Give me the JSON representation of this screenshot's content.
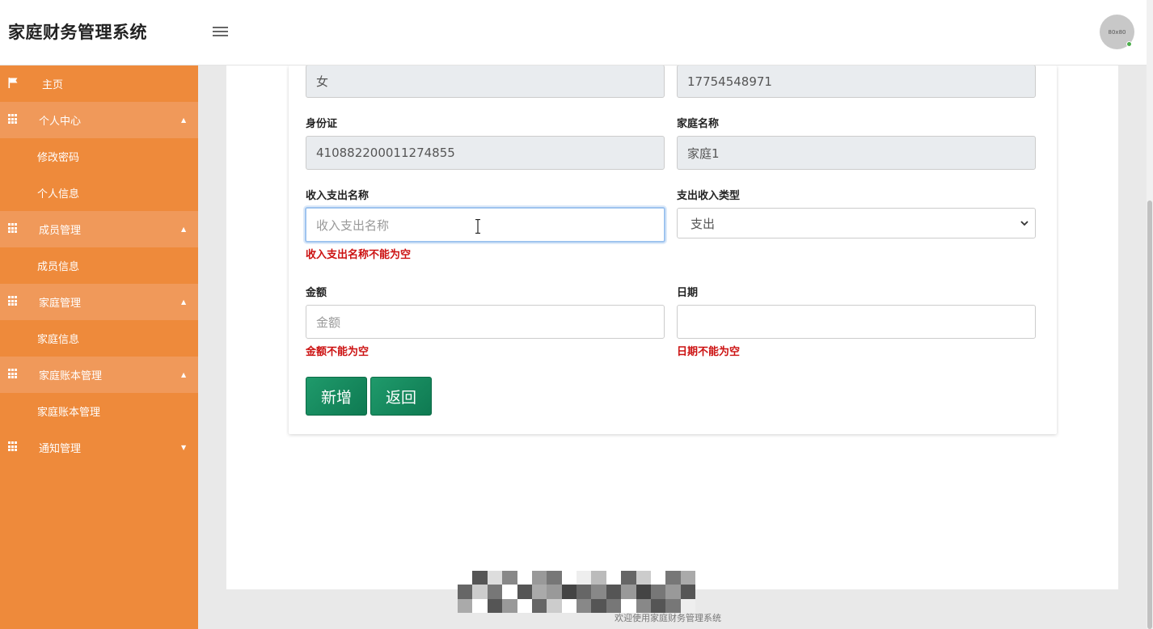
{
  "header": {
    "brand": "家庭财务管理系统",
    "avatar_text": "80x80"
  },
  "sidebar": {
    "items": [
      {
        "label": "主页",
        "type": "top",
        "icon": "flag-icon"
      },
      {
        "label": "个人中心",
        "type": "group",
        "icon": "grid-icon",
        "caret": "▲"
      },
      {
        "label": "修改密码",
        "type": "child"
      },
      {
        "label": "个人信息",
        "type": "child"
      },
      {
        "label": "成员管理",
        "type": "group",
        "icon": "grid-icon",
        "caret": "▲"
      },
      {
        "label": "成员信息",
        "type": "child"
      },
      {
        "label": "家庭管理",
        "type": "group",
        "icon": "grid-icon",
        "caret": "▲"
      },
      {
        "label": "家庭信息",
        "type": "child"
      },
      {
        "label": "家庭账本管理",
        "type": "group",
        "icon": "grid-icon",
        "caret": "▲"
      },
      {
        "label": "家庭账本管理",
        "type": "child"
      },
      {
        "label": "通知管理",
        "type": "top-group",
        "icon": "grid-icon",
        "caret": "▼"
      }
    ]
  },
  "form": {
    "gender_value": "女",
    "phone_value": "17754548971",
    "id_label": "身份证",
    "id_value": "410882200011274855",
    "family_label": "家庭名称",
    "family_value": "家庭1",
    "name_label": "收入支出名称",
    "name_placeholder": "收入支出名称",
    "name_error": "收入支出名称不能为空",
    "type_label": "支出收入类型",
    "type_value": "支出",
    "amount_label": "金额",
    "amount_placeholder": "金额",
    "amount_error": "金额不能为空",
    "date_label": "日期",
    "date_value": "",
    "date_error": "日期不能为空",
    "add_button": "新增",
    "back_button": "返回"
  },
  "footer": {
    "text": "欢迎使用家庭财务管理系统"
  },
  "colors": {
    "sidebar": "#ee8a3b",
    "sidebar_group": "#f0995a",
    "button": "#1f9a6b",
    "error": "#cc1111"
  }
}
